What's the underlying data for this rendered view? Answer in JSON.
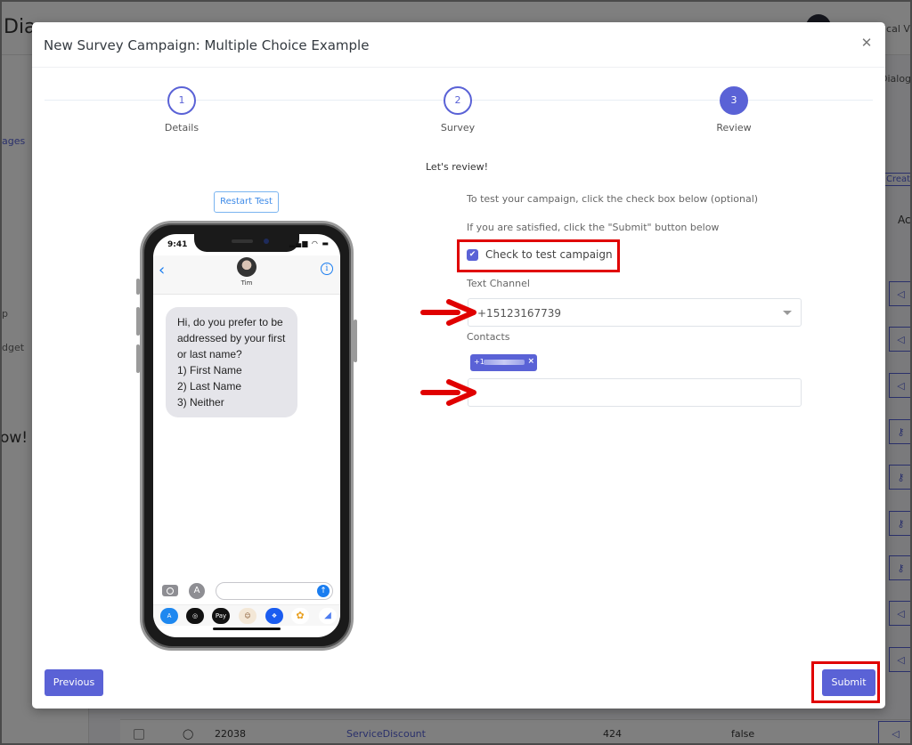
{
  "background": {
    "brand_partial": "Dia",
    "user_partial": "ical V",
    "sidebar_items": [
      "ages",
      "p",
      "dget"
    ],
    "sidebar_heading_partial": "ow!",
    "content_tab_partial": "Dialog",
    "create_button_partial": "Create",
    "column_header_partial": "Ac",
    "table_row": {
      "id": "22038",
      "name": "ServiceDiscount",
      "count": "424",
      "flag": "false"
    }
  },
  "modal": {
    "title": "New Survey Campaign: Multiple Choice Example",
    "close_icon": "close-icon",
    "steps": [
      {
        "number": "1",
        "label": "Details",
        "state": "complete"
      },
      {
        "number": "2",
        "label": "Survey",
        "state": "complete"
      },
      {
        "number": "3",
        "label": "Review",
        "state": "active"
      }
    ],
    "preview": {
      "restart_label": "Restart Test",
      "status_time": "9:41",
      "status_icons": "▂▄▆ ◠ ▬",
      "contact_name": "Tim",
      "message_lines": [
        "Hi, do you prefer to be",
        "addressed by your first",
        "or last name?",
        "1) First Name",
        "2) Last Name",
        "3) Neither"
      ],
      "tray_apps": [
        "App Store",
        "Activity",
        "Apple Pay",
        "Animoji",
        "Dropbox",
        "Photos",
        "More"
      ]
    },
    "review": {
      "title": "Let's review!",
      "instruction_1": "To test your campaign, click the check box below (optional)",
      "instruction_2": "If you are satisfied, click the \"Submit\" button below",
      "test_checkbox_label": "Check to test campaign",
      "test_checkbox_checked": true,
      "text_channel_label": "Text Channel",
      "text_channel_value": "+15123167739",
      "contacts_label": "Contacts",
      "contact_tag_prefix": "+1",
      "contact_tag_remove": "×",
      "contacts_input_value": ""
    },
    "footer": {
      "previous_label": "Previous",
      "submit_label": "Submit"
    }
  },
  "annotations": {
    "color": "#e00000",
    "highlighted": [
      "test-checkbox",
      "submit-button"
    ],
    "arrows_pointing_to": [
      "text-channel-select",
      "contacts-input"
    ]
  },
  "colors": {
    "accent": "#5a62d6",
    "link_blue": "#3d8ae8",
    "ios_blue": "#1a7df0"
  }
}
